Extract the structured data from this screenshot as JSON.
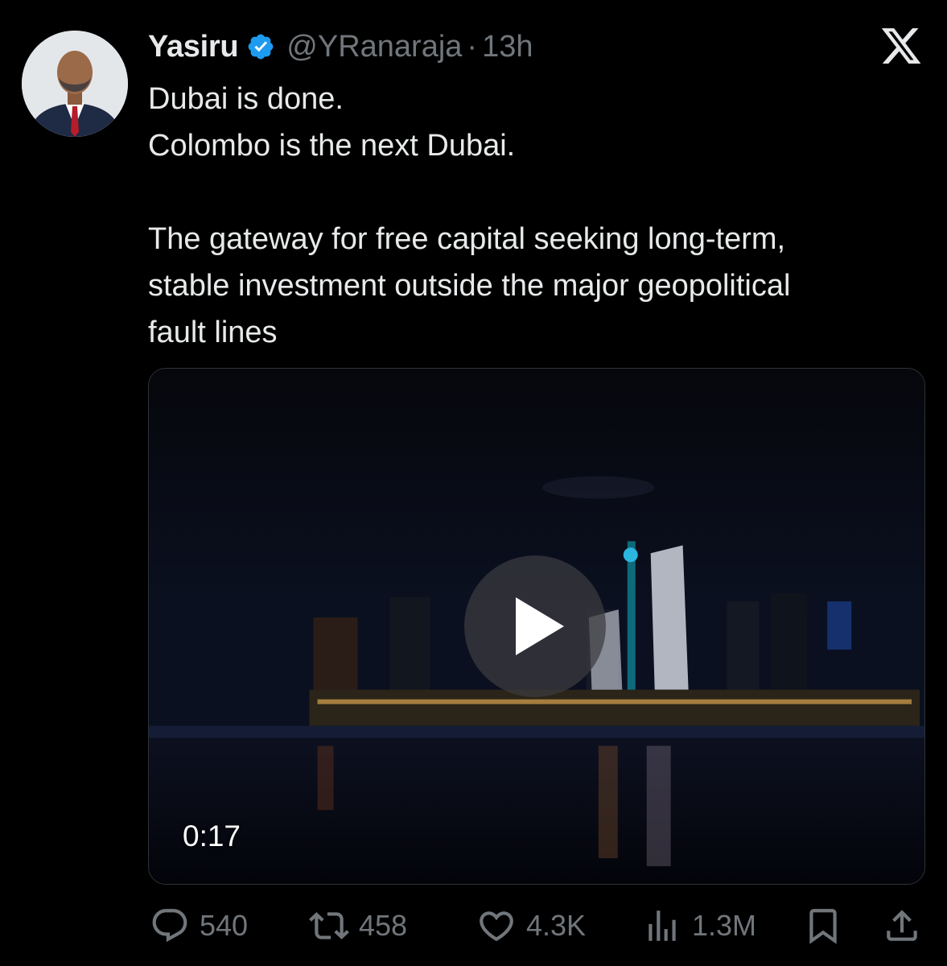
{
  "tweet": {
    "author_name": "Yasiru",
    "handle": "@YRanaraja",
    "separator": "·",
    "time": "13h",
    "text_lines": [
      "Dubai is done.",
      "Colombo is the next Dubai.",
      "The gateway for free capital seeking long-term,",
      "stable investment outside the major geopolitical",
      "fault lines"
    ]
  },
  "media": {
    "duration": "0:17"
  },
  "actions": {
    "replies": "540",
    "retweets": "458",
    "likes": "4.3K",
    "views": "1.3M"
  },
  "colors": {
    "background": "#000000",
    "text": "#e7e9ea",
    "muted": "#71767b",
    "verified": "#1d9bf0"
  },
  "icons": [
    "x-logo-icon",
    "verified-badge-icon",
    "play-icon",
    "reply-icon",
    "retweet-icon",
    "like-icon",
    "views-icon",
    "bookmark-icon",
    "share-icon"
  ]
}
